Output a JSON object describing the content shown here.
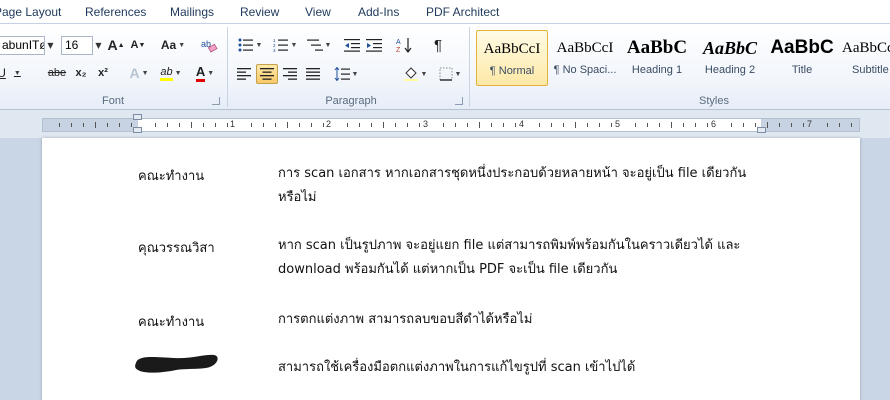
{
  "tabs": [
    "Page Layout",
    "References",
    "Mailings",
    "Review",
    "View",
    "Add-Ins",
    "PDF Architect"
  ],
  "font": {
    "name": "abunITø",
    "size": "16",
    "group_label": "Font",
    "grow_label": "A",
    "shrink_label": "A",
    "change_case_label": "Aa",
    "underline_label": "U",
    "strikethrough_label": "abe",
    "subscript_label": "x₂",
    "superscript_label": "x²",
    "highlight_label": "ab",
    "font_color_label": "A"
  },
  "paragraph": {
    "group_label": "Paragraph",
    "show_marks_label": "¶"
  },
  "styles": {
    "group_label": "Styles",
    "items": [
      {
        "sample": "AaBbCcI",
        "name": "¶ Normal"
      },
      {
        "sample": "AaBbCcI",
        "name": "¶ No Spaci..."
      },
      {
        "sample": "AaBbC",
        "name": "Heading 1"
      },
      {
        "sample": "AaBbC",
        "name": "Heading 2"
      },
      {
        "sample": "AaBbC",
        "name": "Title"
      },
      {
        "sample": "AaBbCc",
        "name": "Subtitle"
      }
    ]
  },
  "ruler": {
    "numbers": [
      "1",
      "2",
      "3",
      "4",
      "5",
      "6",
      "7"
    ]
  },
  "document": {
    "rows": [
      {
        "label": "คณะทำงาน",
        "text": "การ scan เอกสาร หากเอกสารชุดหนึ่งประกอบด้วยหลายหน้า จะอยู่เป็น file เดียวกัน หรือไม่"
      },
      {
        "label": "คุณวรรณวิสา",
        "text": "หาก scan เป็นรูปภาพ จะอยู่แยก file แต่สามารถพิมพ์พร้อมกันในคราวเดียวได้ และ download พร้อมกันได้ แต่หากเป็น PDF จะเป็น file เดียวกัน"
      },
      {
        "label": "คณะทำงาน",
        "text": "การตกแต่งภาพ สามารถลบขอบสีดำได้หรือไม่"
      },
      {
        "label": "",
        "text": "สามารถใช้เครื่องมือตกแต่งภาพในการแก้ไขรูปที่  scan เข้าไปได้"
      }
    ]
  }
}
